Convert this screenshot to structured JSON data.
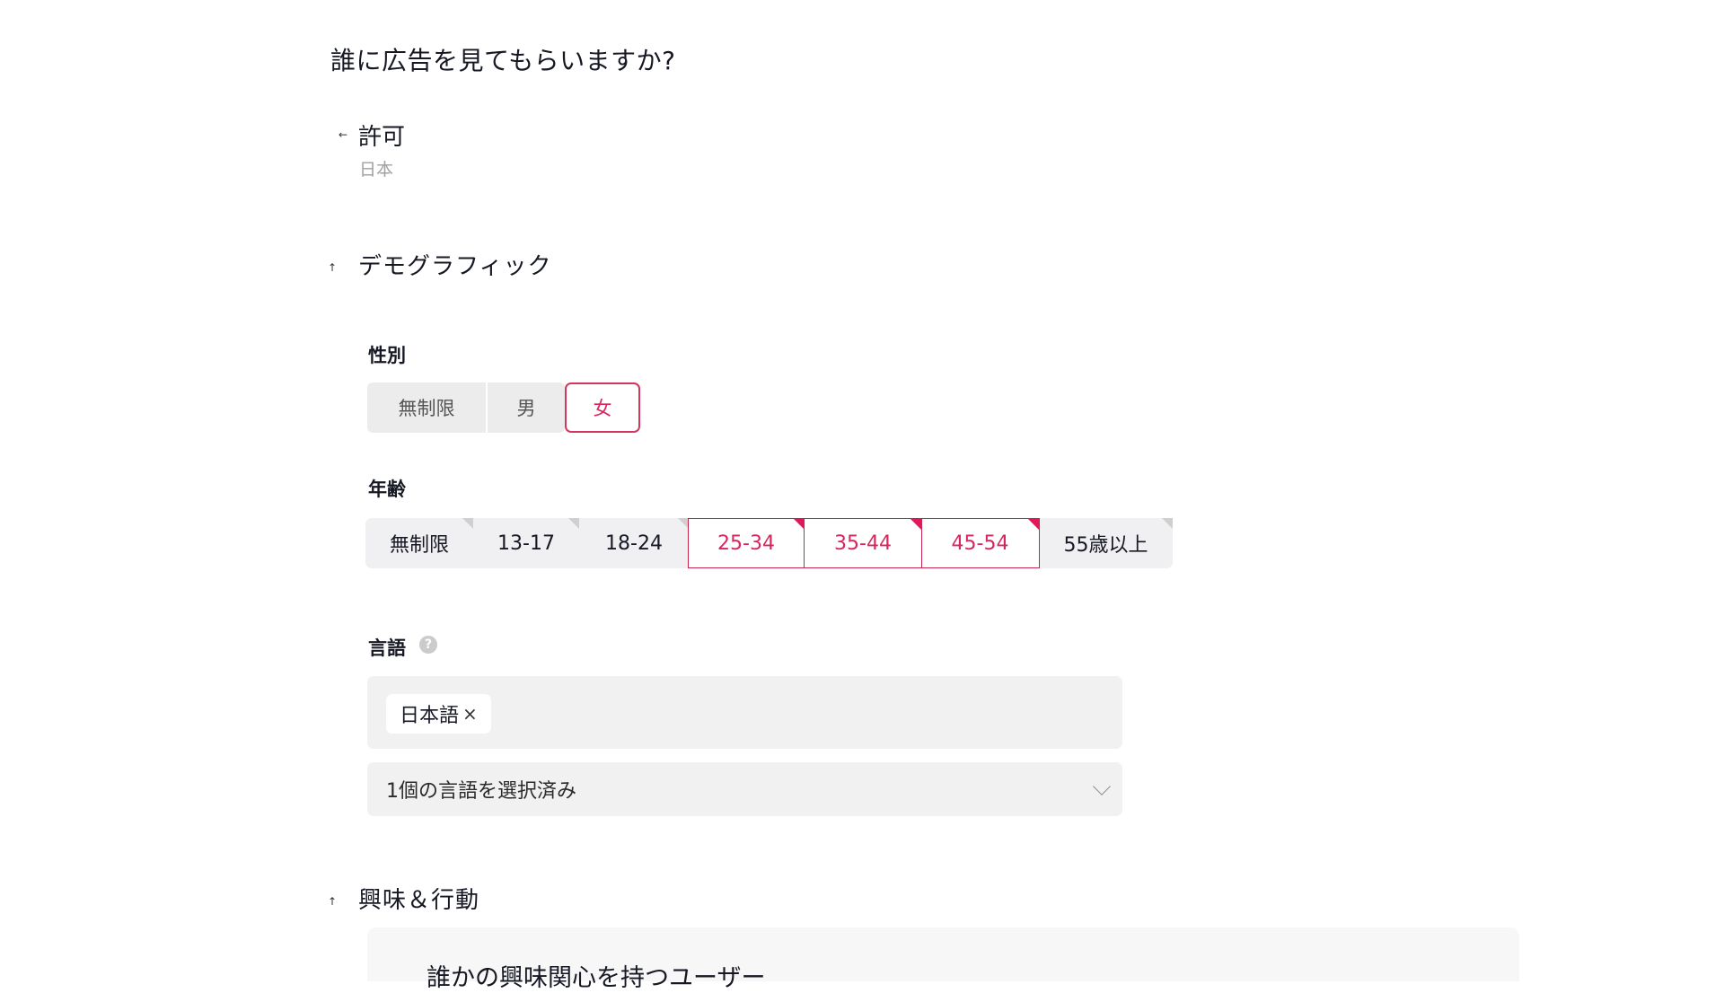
{
  "page": {
    "title": "誰に広告を見てもらいますか?"
  },
  "location": {
    "arrow_icon": "arrow-left",
    "title": "許可",
    "value": "日本"
  },
  "demographics": {
    "arrow_icon": "arrow-up",
    "title": "デモグラフィック",
    "gender": {
      "label": "性別",
      "options": [
        {
          "label": "無制限",
          "selected": false
        },
        {
          "label": "男",
          "selected": false
        },
        {
          "label": "女",
          "selected": true
        }
      ]
    },
    "age": {
      "label": "年齢",
      "options": [
        {
          "label": "無制限",
          "selected": false
        },
        {
          "label": "13-17",
          "selected": false
        },
        {
          "label": "18-24",
          "selected": false
        },
        {
          "label": "25-34",
          "selected": true
        },
        {
          "label": "35-44",
          "selected": true
        },
        {
          "label": "45-54",
          "selected": true
        },
        {
          "label": "55歳以上",
          "selected": false
        }
      ]
    },
    "language": {
      "label": "言語",
      "help_icon": "?",
      "chips": [
        {
          "label": "日本語",
          "remove": "×"
        }
      ],
      "select_summary": "1個の言語を選択済み"
    }
  },
  "interests": {
    "arrow_icon": "arrow-up",
    "title": "興味＆行動",
    "panel_text": "誰かの興味関心を持つユーザー"
  },
  "colors": {
    "accent": "#d7265d",
    "accent_corner": "#e0195a",
    "segment_bg": "#f0f0f2",
    "input_bg": "#f1f1f1"
  }
}
